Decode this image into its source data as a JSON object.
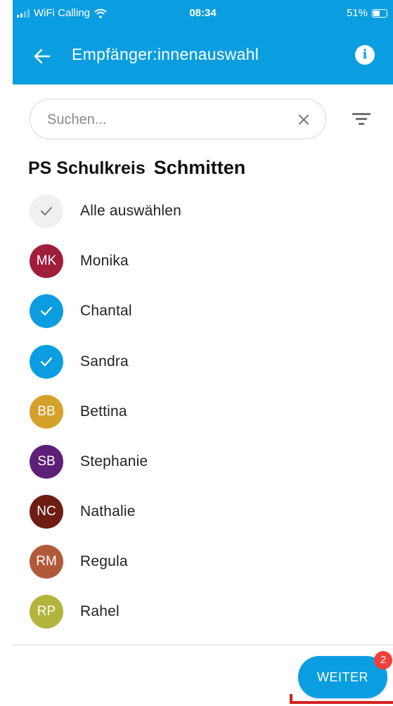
{
  "status_bar": {
    "carrier": "WiFi Calling",
    "time": "08:34",
    "battery": "51%"
  },
  "header": {
    "title": "Empfänger:innenauswahl",
    "back_icon": "arrow-left-icon",
    "info_icon": "info-icon",
    "info_glyph": "i"
  },
  "search": {
    "placeholder": "Suchen...",
    "value": ""
  },
  "group": {
    "title_left": "PS Schulkreis",
    "title_right": "Schmitten"
  },
  "select_all_label": "Alle auswählen",
  "recipients": [
    {
      "initials": "MK",
      "name": "Monika",
      "color": "#a01d3c",
      "selected": false
    },
    {
      "initials": "",
      "name": "Chantal",
      "color": "#0a9ee0",
      "selected": true
    },
    {
      "initials": "",
      "name": "Sandra",
      "color": "#0a9ee0",
      "selected": true
    },
    {
      "initials": "BB",
      "name": "Bettina",
      "color": "#d6a12a",
      "selected": false
    },
    {
      "initials": "SB",
      "name": "Stephanie",
      "color": "#5e1f78",
      "selected": false
    },
    {
      "initials": "NC",
      "name": "Nathalie",
      "color": "#6e1d14",
      "selected": false
    },
    {
      "initials": "RM",
      "name": "Regula",
      "color": "#b15a39",
      "selected": false
    },
    {
      "initials": "RP",
      "name": "Rahel",
      "color": "#b2b43c",
      "selected": false
    }
  ],
  "footer": {
    "next_label": "WEITER",
    "selected_count": "2"
  },
  "colors": {
    "primary": "#0a9ee0",
    "badge": "#f2403a"
  }
}
